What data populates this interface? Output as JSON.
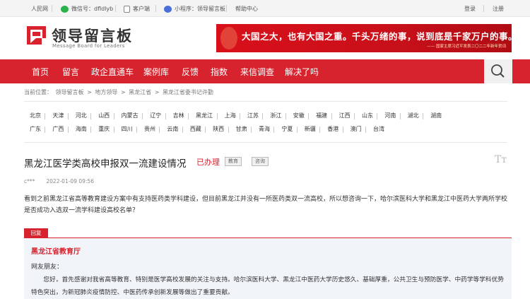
{
  "topbar": {
    "people": "人民网",
    "wechat": "微信号：dfldlyb",
    "client": "客户端",
    "miniapp": "小程序：领导留言板",
    "help": "帮助中心",
    "login": "登录",
    "register": "注册"
  },
  "logo": {
    "cn": "领导留言板",
    "en": "Message Board for Leaders"
  },
  "banner": {
    "main": "大国之大，也有大国之重。千头万绪的事，说到底是千家万户的事。",
    "sub": "—— 国家主席习近平发表二〇二二年新年贺词"
  },
  "nav": {
    "items": [
      "首页",
      "留言",
      "政企直通车",
      "案例库",
      "反馈",
      "指数",
      "来信调查",
      "解决了吗"
    ],
    "search_icon": "search-icon"
  },
  "breadcrumb": {
    "label": "当前位置：",
    "items": [
      "领导留言板",
      "地方领导",
      "黑龙江省",
      "黑龙江省委书记许勤"
    ],
    "sep": ">"
  },
  "regions": {
    "row1": [
      "北京",
      "天津",
      "河北",
      "山西",
      "内蒙古",
      "辽宁",
      "吉林",
      "黑龙江",
      "上海",
      "江苏",
      "浙江",
      "安徽",
      "福建",
      "江西",
      "山东",
      "河南",
      "湖北",
      "湖南"
    ],
    "row2": [
      "广东",
      "广西",
      "海南",
      "重庆",
      "四川",
      "贵州",
      "云南",
      "西藏",
      "陕西",
      "甘肃",
      "青海",
      "宁夏",
      "新疆",
      "香港",
      "澳门",
      "台湾"
    ]
  },
  "message": {
    "title": "黑龙江医学类高校申报双一流建设情况",
    "status": "已办理",
    "tags": [
      "教育",
      "咨询"
    ],
    "font_icon": "Tт",
    "author": "c***",
    "date": "2022-01-09 09:56",
    "body": "看到之前黑龙江省高等教育建设方案中有支持医药类学科建设，但目前黑龙江并没有一所医药类双一流高校，所以想咨询一下，哈尔滨医科大学和黑龙江中医药大学两所学校是否成功入选双一流学科建设高校名单？"
  },
  "reply": {
    "tag": "回复",
    "org": "黑龙江省教育厅",
    "greeting": "网友朋友：",
    "body": "您好，首先感谢对我省高等教育、特别是医学高校发展的关注与支持。哈尔滨医科大学、黑龙江中医药大学历史悠久、基础厚重，公共卫生与预防医学、中药学等学科优势特色突出，为新冠肺炎疫情防控、中医药传承创新发展等做出了重要贡献。"
  },
  "colors": {
    "brand_red": "#d7232e",
    "reply_bg": "#f1f4f9"
  }
}
